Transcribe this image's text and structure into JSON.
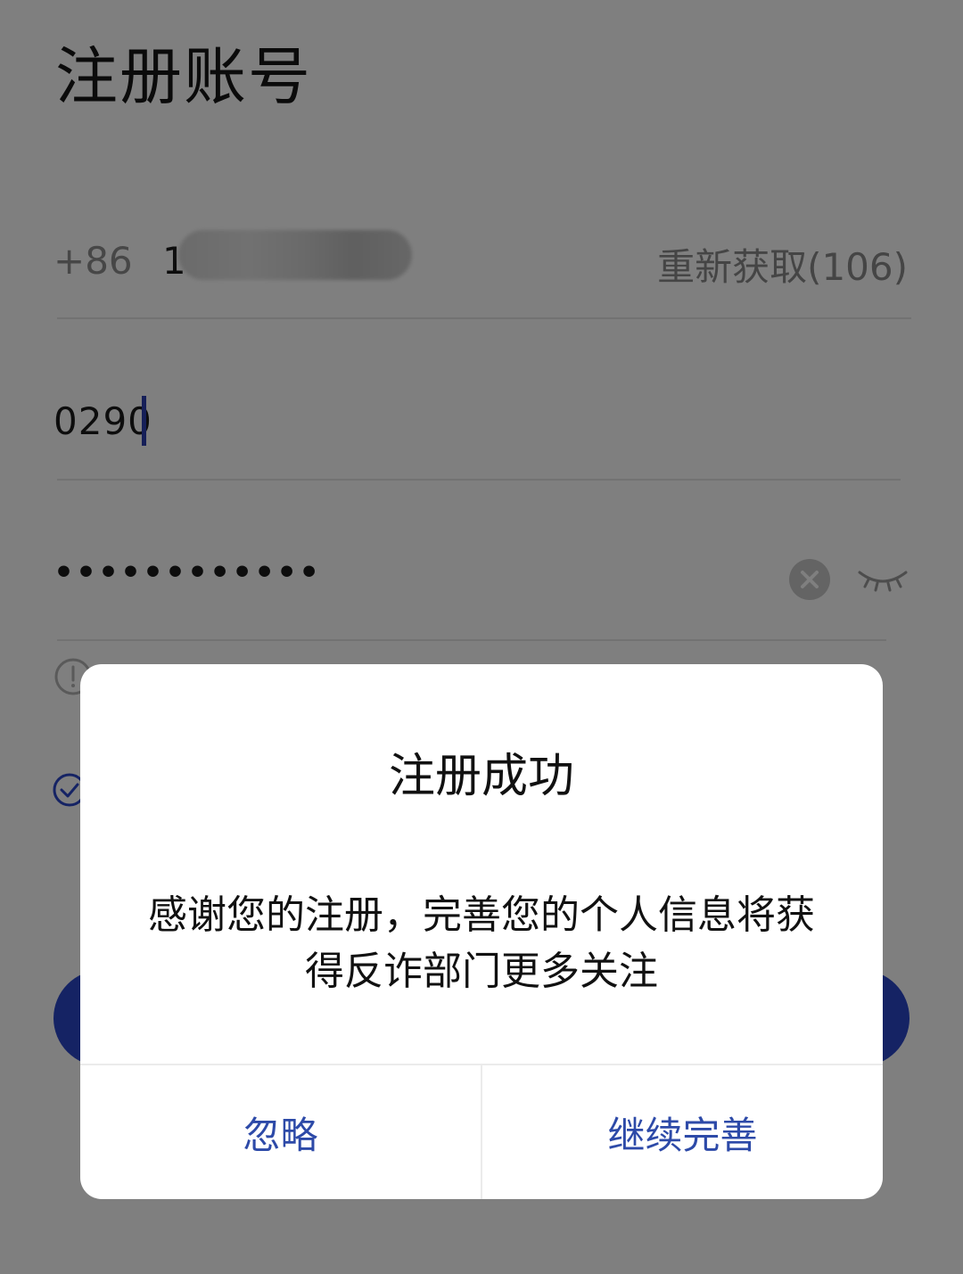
{
  "page": {
    "title": "注册账号"
  },
  "phone": {
    "country_code": "+86",
    "number_visible": "1",
    "resend_label": "重新获取(106)"
  },
  "code": {
    "value": "0290"
  },
  "password": {
    "masked_value": "••••••••••••"
  },
  "dialog": {
    "title": "注册成功",
    "message": "感谢您的注册，完善您的个人信息将获得反诈部门更多关注",
    "ignore_label": "忽略",
    "continue_label": "继续完善"
  },
  "colors": {
    "accent": "#2b47c9",
    "dialog_button_text": "#2d4aa8"
  },
  "icons": {
    "clear": "clear-icon",
    "eye": "eye-closed-icon",
    "hint": "info-icon",
    "agree": "check-circle-icon"
  }
}
